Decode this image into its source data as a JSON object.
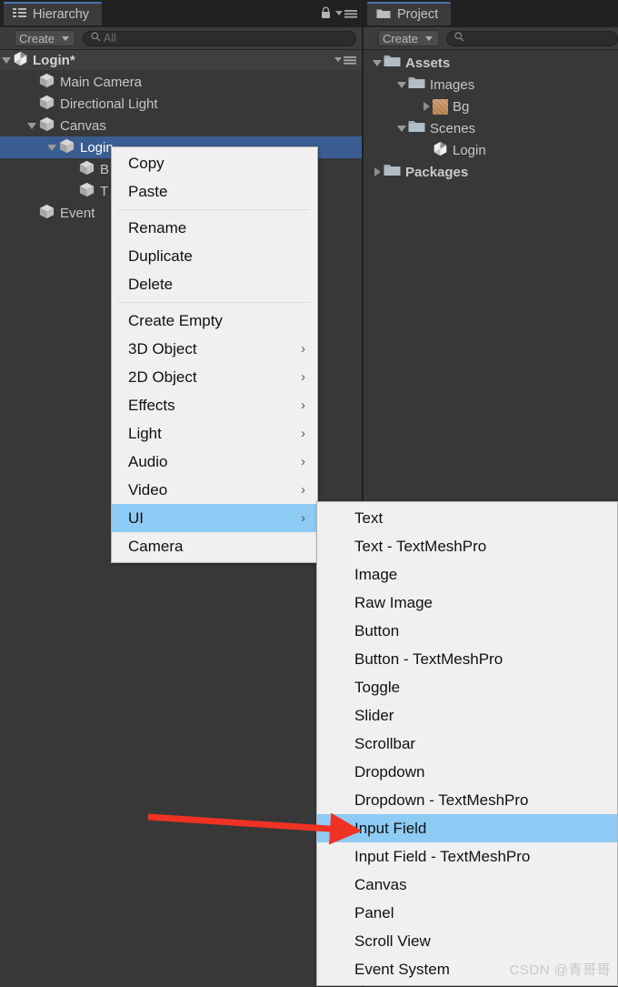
{
  "hierarchy": {
    "tab_label": "Hierarchy",
    "tab_icon": "hierarchy-icon",
    "lock_icon": "lock-icon",
    "menu_icon": "panel-menu-icon",
    "create_label": "Create",
    "search_placeholder": "All",
    "search_value": "All",
    "search_icon": "search-icon",
    "scene": {
      "label": "Login*",
      "icon": "unity-scene-icon"
    },
    "items": [
      {
        "label": "Main Camera",
        "icon": "gameobject-cube-icon",
        "indent": 1,
        "twisty": "none",
        "selected": false
      },
      {
        "label": "Directional Light",
        "icon": "gameobject-cube-icon",
        "indent": 1,
        "twisty": "none",
        "selected": false
      },
      {
        "label": "Canvas",
        "icon": "gameobject-cube-icon",
        "indent": 1,
        "twisty": "expanded",
        "selected": false
      },
      {
        "label": "Login",
        "icon": "gameobject-cube-icon",
        "indent": 2,
        "twisty": "expanded",
        "selected": true
      },
      {
        "label": "B",
        "icon": "gameobject-cube-icon",
        "indent": 3,
        "twisty": "none",
        "selected": false
      },
      {
        "label": "T",
        "icon": "gameobject-cube-icon",
        "indent": 3,
        "twisty": "none",
        "selected": false
      },
      {
        "label": "Event",
        "icon": "gameobject-cube-icon",
        "indent": 1,
        "twisty": "none",
        "selected": false
      }
    ]
  },
  "project": {
    "tab_label": "Project",
    "tab_icon": "folder-icon",
    "create_label": "Create",
    "search_placeholder": "",
    "search_icon": "search-icon",
    "items": [
      {
        "label": "Assets",
        "icon": "folder-icon",
        "indent": 0,
        "twisty": "expanded",
        "bold": true
      },
      {
        "label": "Images",
        "icon": "folder-icon",
        "indent": 1,
        "twisty": "expanded",
        "bold": false
      },
      {
        "label": "Bg",
        "icon": "texture-icon",
        "indent": 2,
        "twisty": "collapsed",
        "bold": false
      },
      {
        "label": "Scenes",
        "icon": "folder-icon",
        "indent": 1,
        "twisty": "expanded",
        "bold": false
      },
      {
        "label": "Login",
        "icon": "unity-scene-icon",
        "indent": 2,
        "twisty": "none",
        "bold": false
      },
      {
        "label": "Packages",
        "icon": "folder-icon",
        "indent": 0,
        "twisty": "collapsed",
        "bold": true
      }
    ]
  },
  "context_menu": {
    "groups": [
      [
        {
          "label": "Copy",
          "submenu": false,
          "highlight": false
        },
        {
          "label": "Paste",
          "submenu": false,
          "highlight": false
        }
      ],
      [
        {
          "label": "Rename",
          "submenu": false,
          "highlight": false
        },
        {
          "label": "Duplicate",
          "submenu": false,
          "highlight": false
        },
        {
          "label": "Delete",
          "submenu": false,
          "highlight": false
        }
      ],
      [
        {
          "label": "Create Empty",
          "submenu": false,
          "highlight": false
        },
        {
          "label": "3D Object",
          "submenu": true,
          "highlight": false
        },
        {
          "label": "2D Object",
          "submenu": true,
          "highlight": false
        },
        {
          "label": "Effects",
          "submenu": true,
          "highlight": false
        },
        {
          "label": "Light",
          "submenu": true,
          "highlight": false
        },
        {
          "label": "Audio",
          "submenu": true,
          "highlight": false
        },
        {
          "label": "Video",
          "submenu": true,
          "highlight": false
        },
        {
          "label": "UI",
          "submenu": true,
          "highlight": true
        },
        {
          "label": "Camera",
          "submenu": false,
          "highlight": false
        }
      ]
    ],
    "submenu_arrow_glyph": "›"
  },
  "ui_submenu": {
    "items": [
      {
        "label": "Text",
        "highlight": false
      },
      {
        "label": "Text - TextMeshPro",
        "highlight": false
      },
      {
        "label": "Image",
        "highlight": false
      },
      {
        "label": "Raw Image",
        "highlight": false
      },
      {
        "label": "Button",
        "highlight": false
      },
      {
        "label": "Button - TextMeshPro",
        "highlight": false
      },
      {
        "label": "Toggle",
        "highlight": false
      },
      {
        "label": "Slider",
        "highlight": false
      },
      {
        "label": "Scrollbar",
        "highlight": false
      },
      {
        "label": "Dropdown",
        "highlight": false
      },
      {
        "label": "Dropdown - TextMeshPro",
        "highlight": false
      },
      {
        "label": "Input Field",
        "highlight": true
      },
      {
        "label": "Input Field - TextMeshPro",
        "highlight": false
      },
      {
        "label": "Canvas",
        "highlight": false
      },
      {
        "label": "Panel",
        "highlight": false
      },
      {
        "label": "Scroll View",
        "highlight": false
      },
      {
        "label": "Event System",
        "highlight": false
      }
    ]
  },
  "annotation": {
    "arrow_color": "#f03224",
    "arrow_name": "pointer-arrow-to-input-field"
  },
  "watermark": {
    "text": "CSDN @青哥哥"
  },
  "colors": {
    "panel_bg": "#383838",
    "tabbar_bg": "#212121",
    "toolbar_bg": "#3c3c3c",
    "selection_blue": "#3a5d91",
    "menu_bg": "#f0f0f0",
    "menu_highlight": "#8dcbf5",
    "tab_accent": "#4774b3",
    "arrow_red": "#f03224"
  }
}
